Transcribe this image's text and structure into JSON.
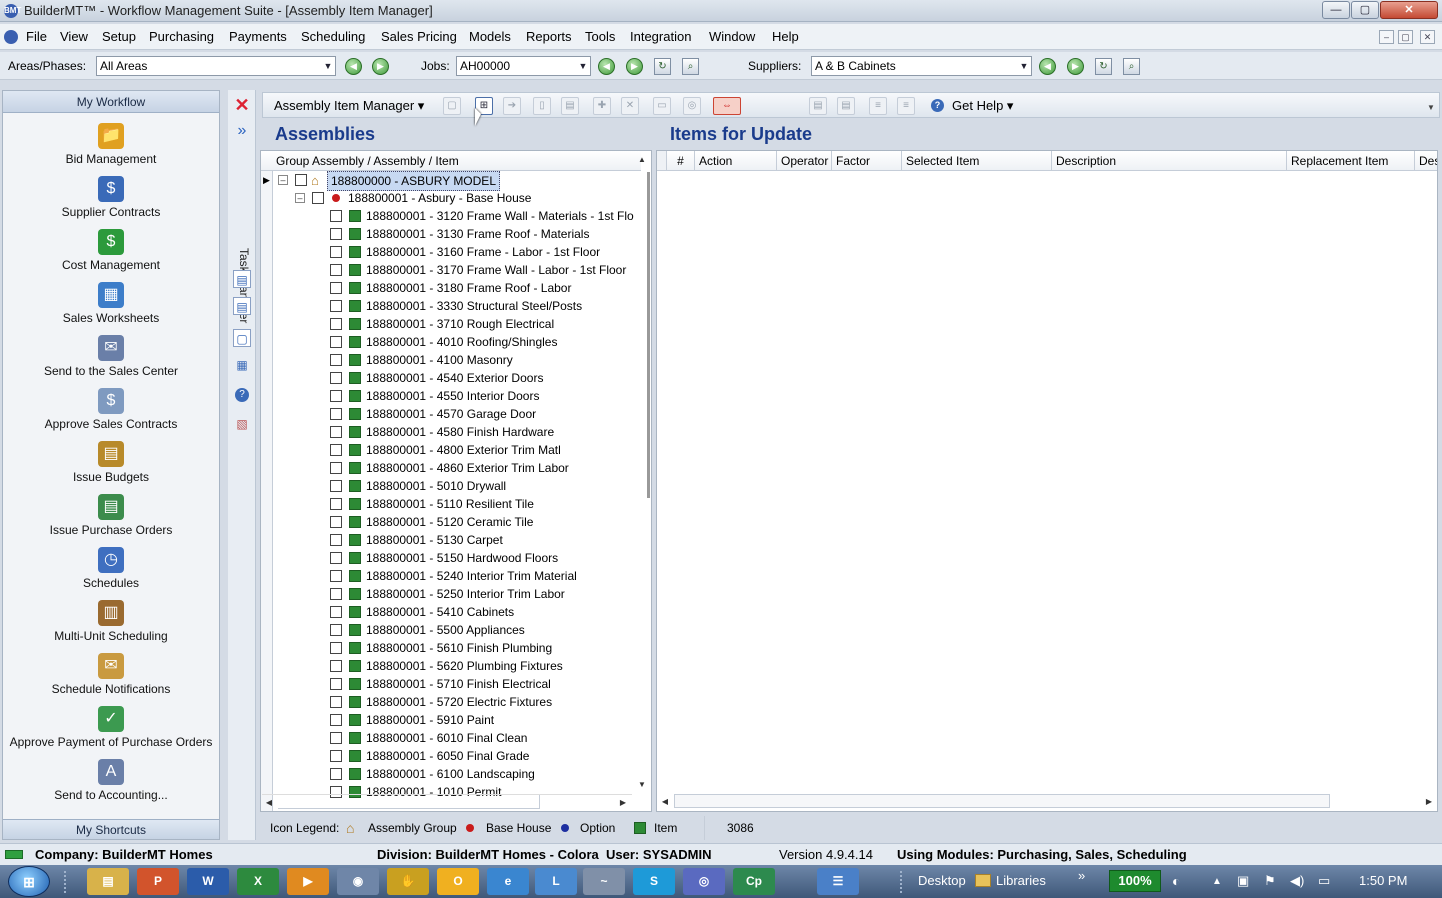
{
  "window": {
    "title": "BuilderMT™ - Workflow Management Suite - [Assembly Item Manager]",
    "app_icon": "BMT",
    "min": "—",
    "max": "▢",
    "close": "✕"
  },
  "menu": [
    "File",
    "View",
    "Setup",
    "Purchasing",
    "Payments",
    "Scheduling",
    "Sales Pricing",
    "Models",
    "Reports",
    "Tools",
    "Integration",
    "Window",
    "Help"
  ],
  "mdi": [
    "–",
    "▢",
    "✕"
  ],
  "filters": {
    "areas_label": "Areas/Phases:",
    "areas_value": "All Areas",
    "jobs_label": "Jobs:",
    "jobs_value": "AH00000",
    "suppliers_label": "Suppliers:",
    "suppliers_value": "A & B Cabinets"
  },
  "workflow": {
    "header": "My Workflow",
    "items": [
      {
        "label": "Bid Management",
        "icon": "folder-globe-icon",
        "color": "#e0a020",
        "glyph": "📁"
      },
      {
        "label": "Supplier Contracts",
        "icon": "contract-icon",
        "color": "#3a6ab8",
        "glyph": "$"
      },
      {
        "label": "Cost Management",
        "icon": "money-icon",
        "color": "#2c9a3c",
        "glyph": "$"
      },
      {
        "label": "Sales Worksheets",
        "icon": "spreadsheet-icon",
        "color": "#3d7dc9",
        "glyph": "▦"
      },
      {
        "label": "Send to the Sales Center",
        "icon": "send-icon",
        "color": "#6a7fa8",
        "glyph": "✉"
      },
      {
        "label": "Approve Sales Contracts",
        "icon": "approve-icon",
        "color": "#7f9ac0",
        "glyph": "$"
      },
      {
        "label": "Issue Budgets",
        "icon": "budget-icon",
        "color": "#b88a2a",
        "glyph": "▤"
      },
      {
        "label": "Issue Purchase Orders",
        "icon": "purchase-order-icon",
        "color": "#3c8c4c",
        "glyph": "▤"
      },
      {
        "label": "Schedules",
        "icon": "schedule-clock-icon",
        "color": "#3f6fc0",
        "glyph": "◷"
      },
      {
        "label": "Multi-Unit Scheduling",
        "icon": "multi-unit-icon",
        "color": "#9a6a30",
        "glyph": "▥"
      },
      {
        "label": "Schedule Notifications",
        "icon": "notification-icon",
        "color": "#c99a40",
        "glyph": "✉"
      },
      {
        "label": "Approve Payment of Purchase Orders",
        "icon": "payment-icon",
        "color": "#3c9a50",
        "glyph": "✓"
      },
      {
        "label": "Send to Accounting...",
        "icon": "accounting-icon",
        "color": "#6a7fa8",
        "glyph": "A"
      }
    ],
    "shortcuts": "My Shortcuts"
  },
  "taskmanager": {
    "label": "Task Manager"
  },
  "toolbar": {
    "manager_label": "Assembly Item Manager ▾",
    "help_label": "Get Help ▾"
  },
  "assemblies": {
    "title": "Assemblies",
    "column": "Group Assembly / Assembly / Item",
    "group": "188800000 - ASBURY MODEL",
    "base": "188800001 - Asbury - Base House",
    "items": [
      "188800001 - 3120  Frame Wall - Materials - 1st Flo",
      "188800001 - 3130  Frame Roof - Materials",
      "188800001 - 3160  Frame - Labor - 1st Floor",
      "188800001 - 3170  Frame Wall - Labor - 1st Floor",
      "188800001 - 3180  Frame Roof - Labor",
      "188800001 - 3330  Structural Steel/Posts",
      "188800001 - 3710  Rough Electrical",
      "188800001 - 4010  Roofing/Shingles",
      "188800001 - 4100  Masonry",
      "188800001 - 4540  Exterior Doors",
      "188800001 - 4550  Interior Doors",
      "188800001 - 4570  Garage Door",
      "188800001 - 4580  Finish Hardware",
      "188800001 - 4800  Exterior Trim Matl",
      "188800001 - 4860  Exterior Trim Labor",
      "188800001 - 5010  Drywall",
      "188800001 - 5110  Resilient Tile",
      "188800001 - 5120  Ceramic Tile",
      "188800001 - 5130  Carpet",
      "188800001 - 5150  Hardwood Floors",
      "188800001 - 5240  Interior Trim Material",
      "188800001 - 5250  Interior Trim Labor",
      "188800001 - 5410  Cabinets",
      "188800001 - 5500  Appliances",
      "188800001 - 5610  Finish Plumbing",
      "188800001 - 5620  Plumbing Fixtures",
      "188800001 - 5710  Finish Electrical",
      "188800001 - 5720  Electric Fixtures",
      "188800001 - 5910  Paint",
      "188800001 - 6010  Final Clean",
      "188800001 - 6050  Final Grade",
      "188800001 - 6100  Landscaping",
      "188800001 - 1010  Permit"
    ]
  },
  "legend": {
    "label": "Icon Legend:",
    "group": "Assembly Group",
    "base": "Base House",
    "option": "Option",
    "item": "Item",
    "count": "3086"
  },
  "update": {
    "title": "Items for Update",
    "columns": [
      "#",
      "Action",
      "Operator",
      "Factor",
      "Selected Item",
      "Description",
      "Replacement Item",
      "Des"
    ]
  },
  "status": {
    "company": "Company: BuilderMT Homes",
    "division": "Division: BuilderMT Homes - Colora",
    "user": "User: SYSADMIN",
    "version": "Version 4.9.4.14",
    "modules": "Using Modules: Purchasing, Sales, Scheduling"
  },
  "taskbar": {
    "apps": [
      {
        "glyph": "▤",
        "color": "#d8b24a",
        "name": "explorer-icon"
      },
      {
        "glyph": "P",
        "color": "#d2542c",
        "name": "powerpoint-icon"
      },
      {
        "glyph": "W",
        "color": "#2b5caa",
        "name": "word-icon"
      },
      {
        "glyph": "X",
        "color": "#2d8a3e",
        "name": "excel-icon"
      },
      {
        "glyph": "▶",
        "color": "#e08a20",
        "name": "media-icon"
      },
      {
        "glyph": "◉",
        "color": "#6f86a8",
        "name": "app-icon"
      },
      {
        "glyph": "✋",
        "color": "#c9a020",
        "name": "hand-icon"
      },
      {
        "glyph": "O",
        "color": "#f0b020",
        "name": "folder-app-icon"
      },
      {
        "glyph": "e",
        "color": "#3a86d0",
        "name": "ie-icon"
      },
      {
        "glyph": "L",
        "color": "#4a8ad0",
        "name": "lync-icon"
      },
      {
        "glyph": "~",
        "color": "#8090a8",
        "name": "paint-icon"
      },
      {
        "glyph": "S",
        "color": "#1e9ad8",
        "name": "skype-icon"
      },
      {
        "glyph": "◎",
        "color": "#5a6ac0",
        "name": "buildermt-icon"
      },
      {
        "glyph": "Cp",
        "color": "#2d8a4e",
        "name": "camtasia-icon"
      },
      {
        "glyph": "☰",
        "color": "#4a80c8",
        "name": "taskview-icon"
      }
    ],
    "desktop": "Desktop",
    "libraries": "Libraries",
    "expand": "»",
    "zoom": "100%",
    "time": "1:50 PM"
  }
}
